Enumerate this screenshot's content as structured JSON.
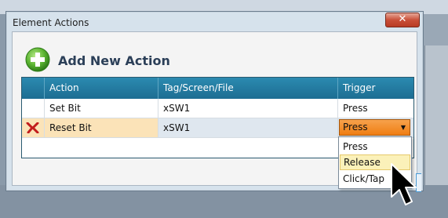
{
  "window": {
    "title": "Element Actions",
    "close_glyph": "✕"
  },
  "add_action": {
    "label": "Add New Action",
    "icon": "add-circle-icon"
  },
  "grid": {
    "columns": [
      "",
      "Action",
      "Tag/Screen/File",
      "Trigger"
    ],
    "rows": [
      {
        "action": "Set Bit",
        "tag": "xSW1",
        "trigger": "Press"
      },
      {
        "action": "Reset Bit",
        "tag": "xSW1",
        "trigger": "Press",
        "selected": true,
        "delete_icon": "delete-x-icon"
      }
    ]
  },
  "trigger_dropdown": {
    "selected": "Press",
    "options": [
      "Press",
      "Release",
      "Click/Tap"
    ],
    "hovered": "Release"
  },
  "colors": {
    "header_blue": "#1d6d92",
    "selected_row": "#fbe3b8",
    "combo_orange": "#ef7d12",
    "hover_yellow": "#fbf1b9"
  }
}
